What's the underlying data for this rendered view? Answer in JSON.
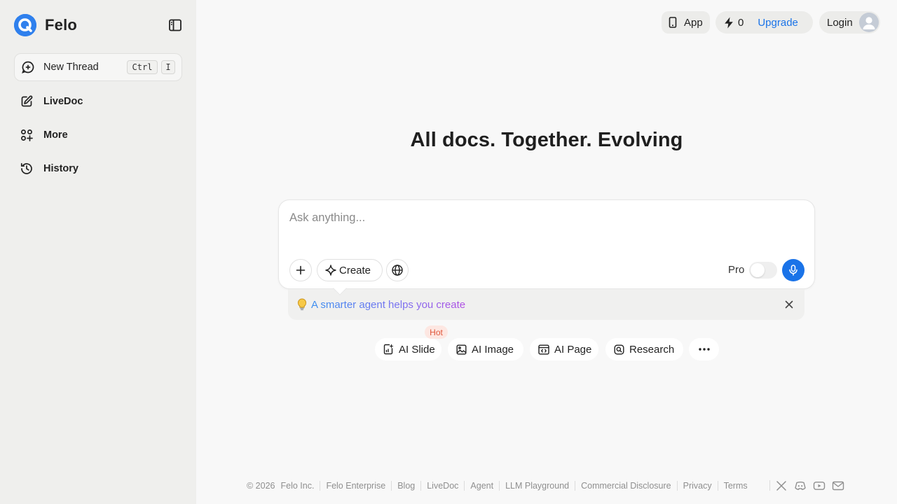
{
  "sidebar": {
    "brand_name": "Felo",
    "new_thread": {
      "label": "New Thread",
      "shortcut_mod": "Ctrl",
      "shortcut_key": "I"
    },
    "items": [
      {
        "label": "LiveDoc",
        "icon": "pen-square-icon"
      },
      {
        "label": "More",
        "icon": "apps-plus-icon"
      },
      {
        "label": "History",
        "icon": "history-icon"
      }
    ]
  },
  "topbar": {
    "app_label": "App",
    "credits": "0",
    "upgrade_label": "Upgrade",
    "login_label": "Login"
  },
  "hero": {
    "title": "All docs. Together. Evolving"
  },
  "search": {
    "placeholder": "Ask anything...",
    "create_label": "Create",
    "pro_label": "Pro"
  },
  "tip": {
    "text": "A smarter agent helps you create"
  },
  "features": {
    "hot_badge": "Hot",
    "items": [
      {
        "label": "AI Slide"
      },
      {
        "label": "AI Image"
      },
      {
        "label": "AI Page"
      },
      {
        "label": "Research"
      }
    ]
  },
  "footer": {
    "copyright": "© 2026",
    "links": [
      "Felo Inc.",
      "Felo Enterprise",
      "Blog",
      "LiveDoc",
      "Agent",
      "LLM Playground",
      "Commercial Disclosure",
      "Privacy",
      "Terms"
    ]
  },
  "colors": {
    "accent": "#1a73e8",
    "sidebar_bg": "#efefed",
    "page_bg": "#f8f8f8",
    "hot_text": "#e0573b"
  }
}
